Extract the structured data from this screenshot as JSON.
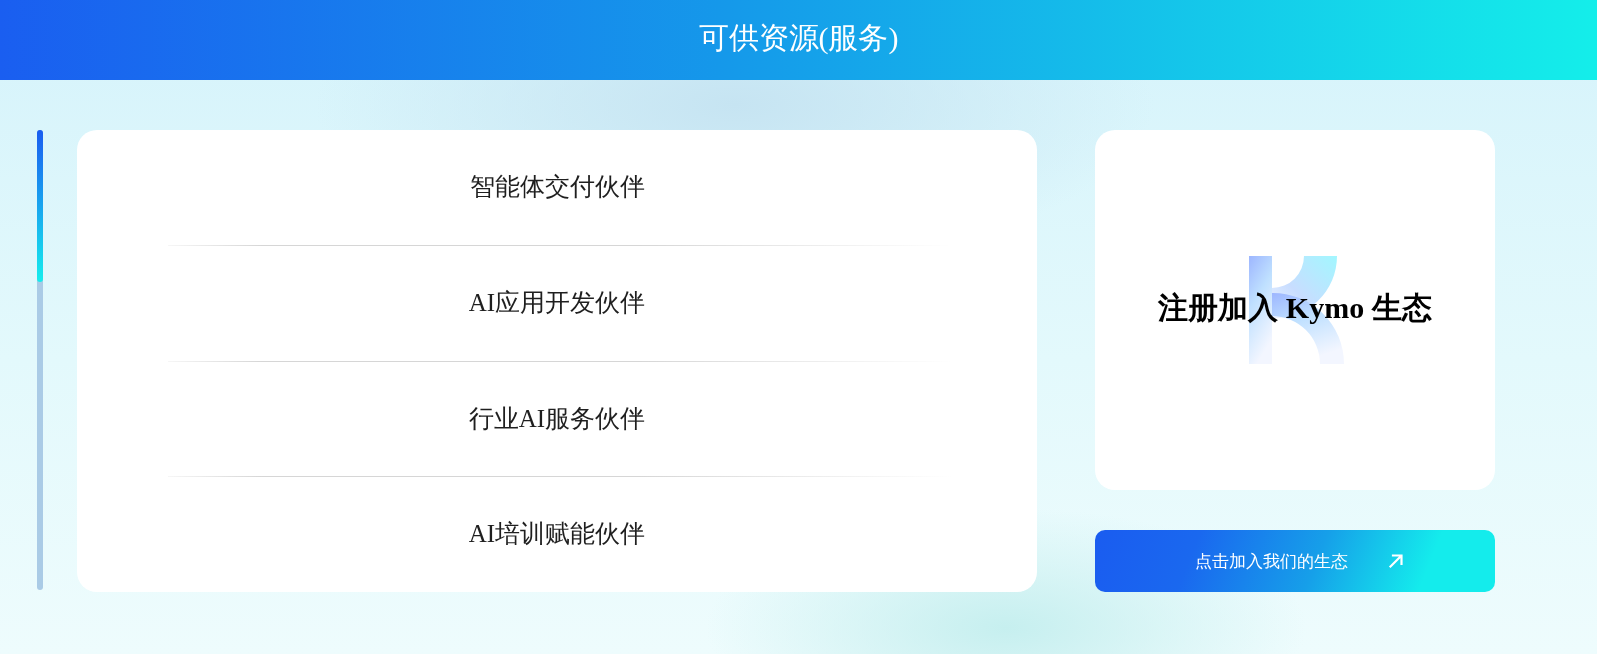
{
  "header": {
    "title": "可供资源(服务)"
  },
  "progress": {
    "level": 0.33
  },
  "partners": [
    {
      "label": "智能体交付伙伴"
    },
    {
      "label": "AI应用开发伙伴"
    },
    {
      "label": "行业AI服务伙伴"
    },
    {
      "label": "AI培训赋能伙伴"
    }
  ],
  "join_card": {
    "title": "注册加入 Kymo 生态"
  },
  "join_button": {
    "label": "点击加入我们的生态"
  }
}
